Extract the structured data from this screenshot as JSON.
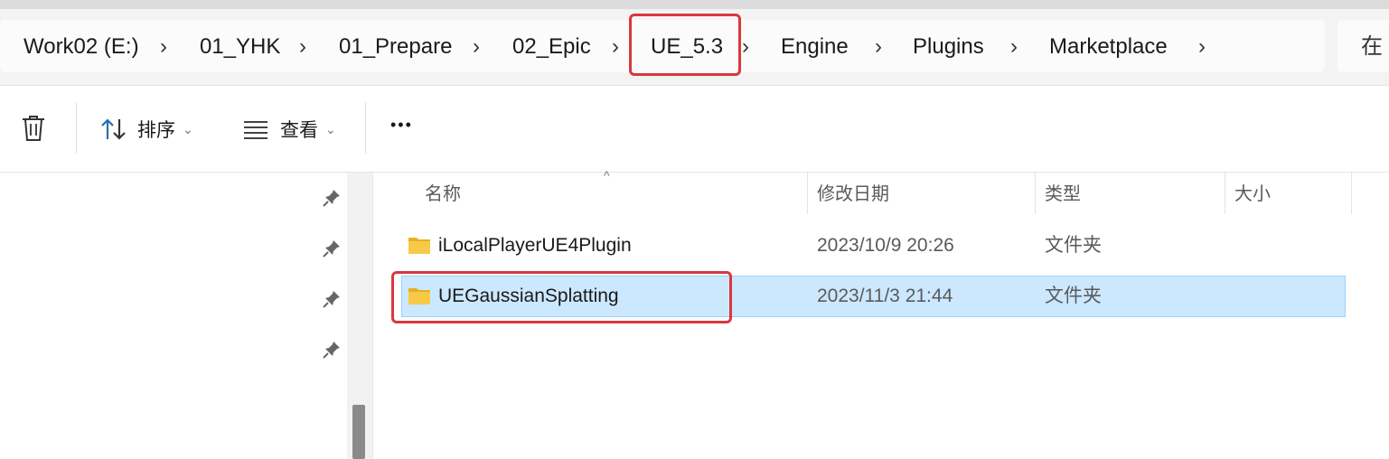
{
  "breadcrumb": {
    "items": [
      "Work02 (E:)",
      "01_YHK",
      "01_Prepare",
      "02_Epic",
      "UE_5.3",
      "Engine",
      "Plugins",
      "Marketplace"
    ],
    "separator": "›",
    "search_hint": "在"
  },
  "toolbar": {
    "delete_icon": "trash-icon",
    "sort_label": "排序",
    "view_label": "查看",
    "more_label": "•••"
  },
  "columns": {
    "name": "名称",
    "date": "修改日期",
    "type": "类型",
    "size": "大小"
  },
  "files": [
    {
      "name": "iLocalPlayerUE4Plugin",
      "date": "2023/10/9 20:26",
      "type": "文件夹",
      "size": ""
    },
    {
      "name": "UEGaussianSplatting",
      "date": "2023/11/3 21:44",
      "type": "文件夹",
      "size": "",
      "selected": true
    }
  ],
  "colors": {
    "highlight_box": "#d9383d",
    "selection": "#cce8ff",
    "folder": "#f7c948"
  }
}
